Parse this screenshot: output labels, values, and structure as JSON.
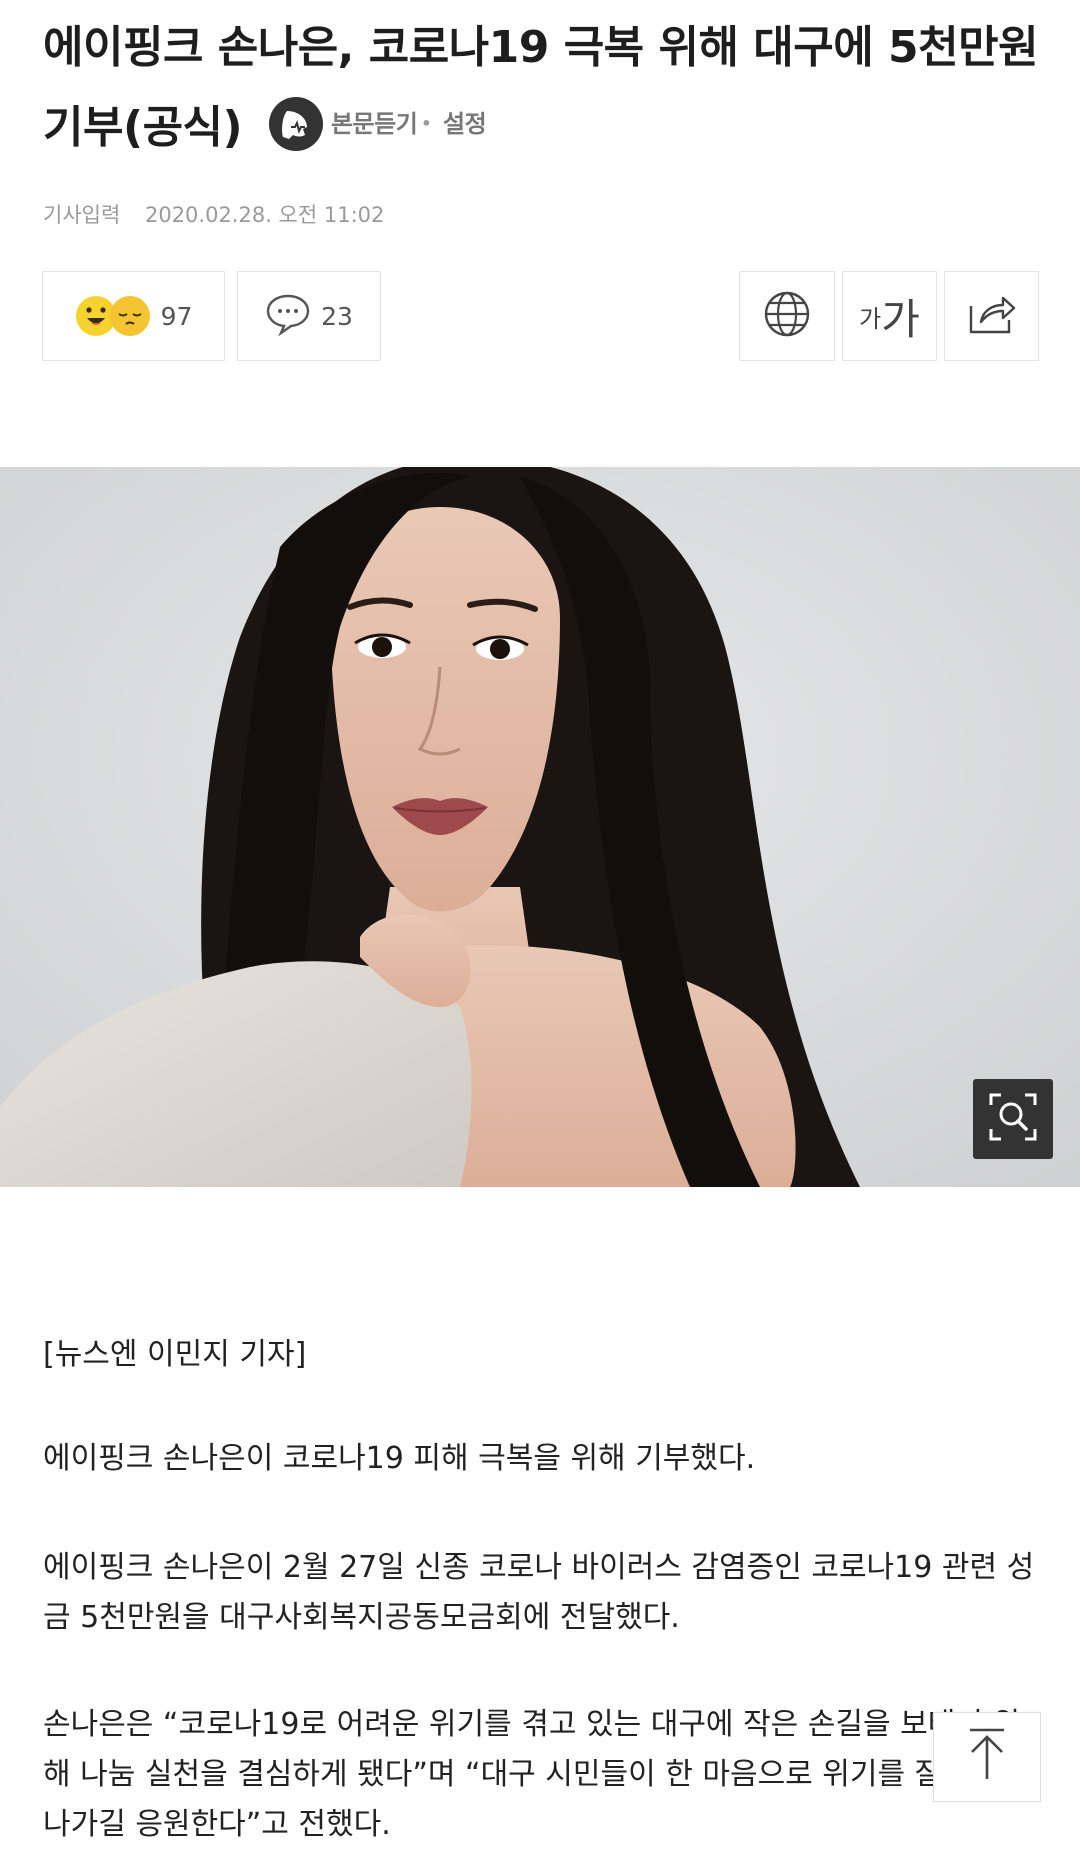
{
  "article": {
    "title": "에이핑크 손나은, 코로나19 극복 위해 대구에 5천만원 기부(공식)",
    "listen_label": "본문듣기",
    "settings_label": "설정",
    "meta_label": "기사입력",
    "published": "2020.02.28. 오전 11:02",
    "reactions_count": "97",
    "comments_count": "23",
    "font_small": "가",
    "font_big": "가",
    "paragraphs": [
      "[뉴스엔 이민지 기자]",
      "에이핑크 손나은이 코로나19 피해 극복을 위해 기부했다.",
      "에이핑크 손나은이 2월 27일 신종 코로나 바이러스 감염증인 코로나19 관련 성금 5천만원을 대구사회복지공동모금회에 전달했다.",
      "손나은은 “코로나19로 어려운 위기를 겪고 있는 대구에 작은 손길을 보태기 위해 나눔 실천을 결심하게 됐다”며 “대구 시민들이 한 마음으로 위기를 잘 극복해나가길 응원한다”고 전했다."
    ]
  },
  "icons": {
    "listen": "listen-speaker-icon",
    "reaction_like": "smile-emoji-icon",
    "reaction_sad": "sleepy-emoji-icon",
    "comment": "comment-bubble-icon",
    "translate": "globe-icon",
    "share": "share-icon",
    "zoom": "zoom-search-icon",
    "scroll_top": "arrow-up-icon"
  },
  "colors": {
    "text": "#1e1e1e",
    "meta": "#9a9a9a",
    "emoji_yellow": "#f7d22e",
    "zoom_bg": "#333333"
  }
}
